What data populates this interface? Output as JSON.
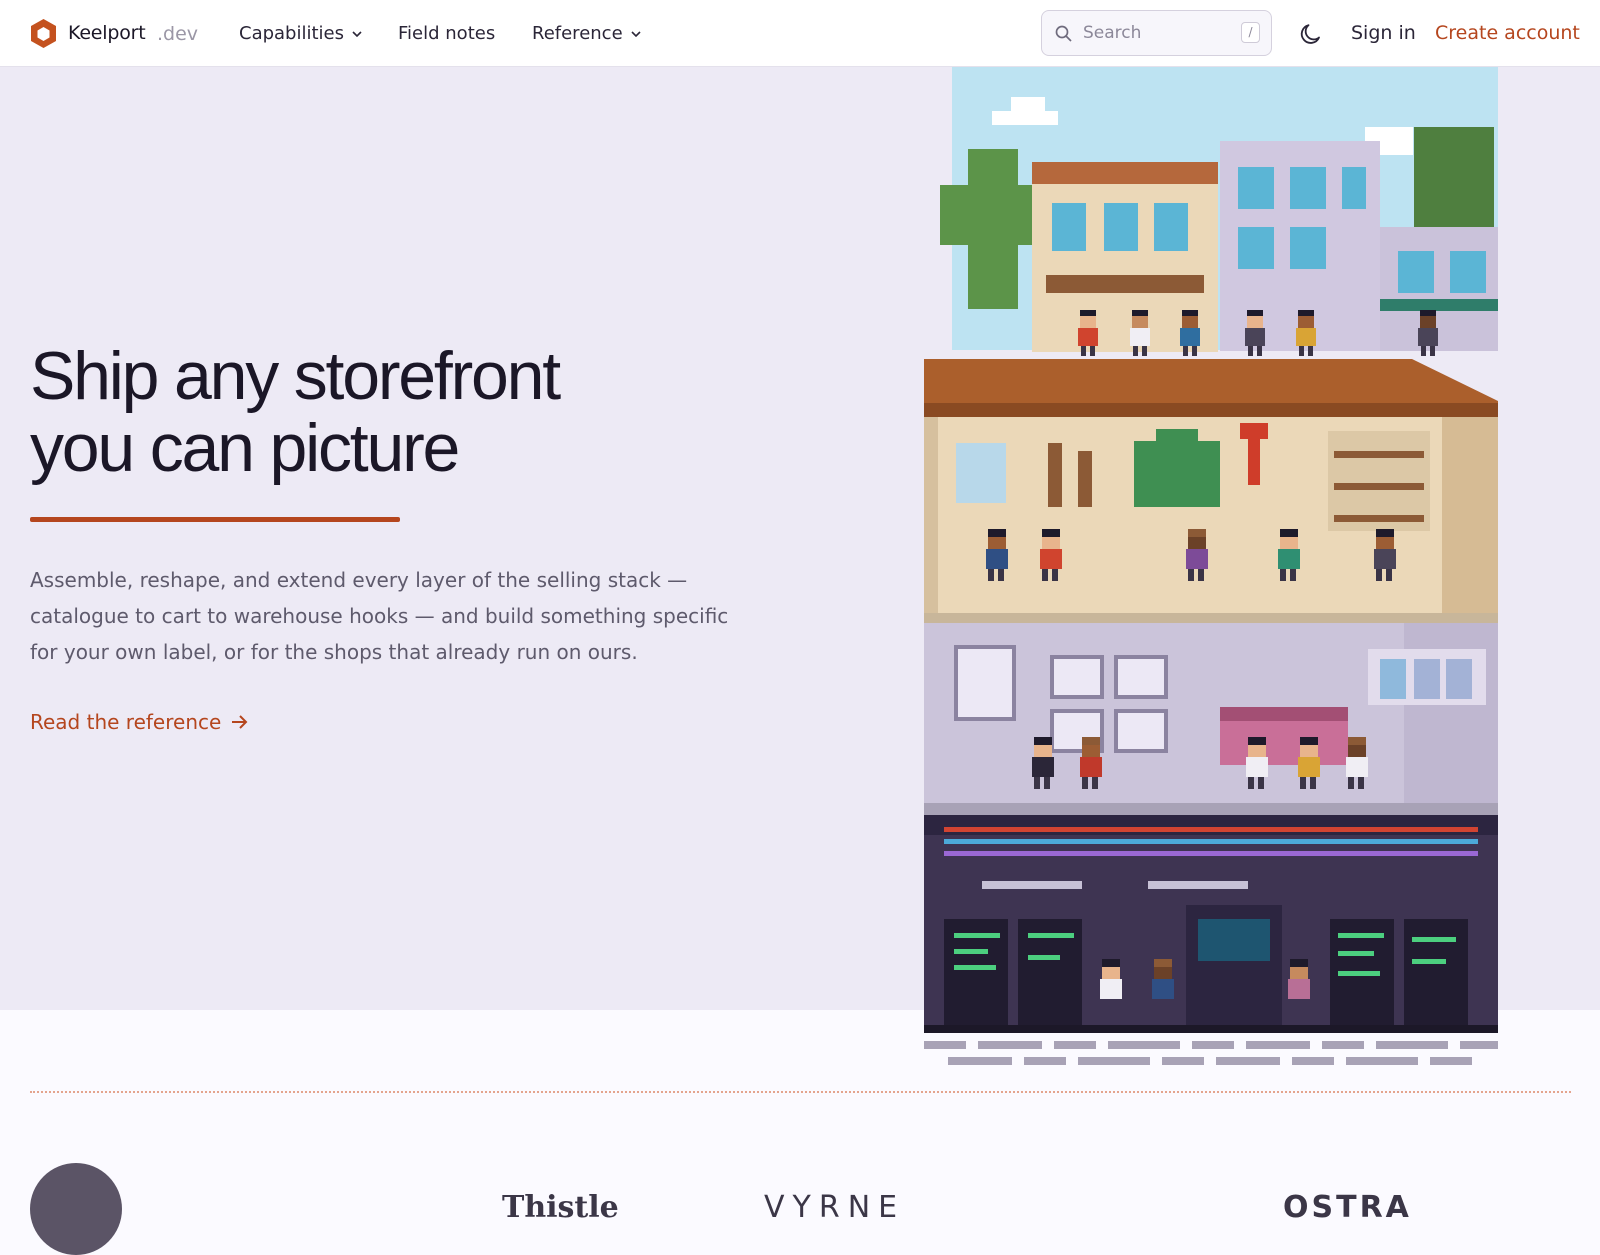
{
  "header": {
    "brand": "Keelport",
    "brand_suffix": ".dev",
    "nav": [
      {
        "label": "Capabilities",
        "has_dropdown": true
      },
      {
        "label": "Field notes",
        "has_dropdown": false
      },
      {
        "label": "Reference",
        "has_dropdown": true
      }
    ],
    "search": {
      "placeholder": "Search",
      "shortcut": "/"
    },
    "theme_icon": "moon-icon",
    "sign_in": "Sign in",
    "create_account": "Create account"
  },
  "hero": {
    "title_line1": "Ship any storefront",
    "title_line2": "you can picture",
    "body": "Assemble, reshape, and extend every layer of the selling stack — catalogue to cart to warehouse hooks — and build something specific for your own label, or for the shops that already run on ours.",
    "link": "Read the reference",
    "link_icon": "arrow-right-icon"
  },
  "logos": [
    "Thistle",
    "VYRNE",
    "OSTRA"
  ],
  "colors": {
    "accent": "#b5461e",
    "hero_bg": "#edeaf5",
    "page_bg": "#fbfaff",
    "text": "#1b1727"
  }
}
